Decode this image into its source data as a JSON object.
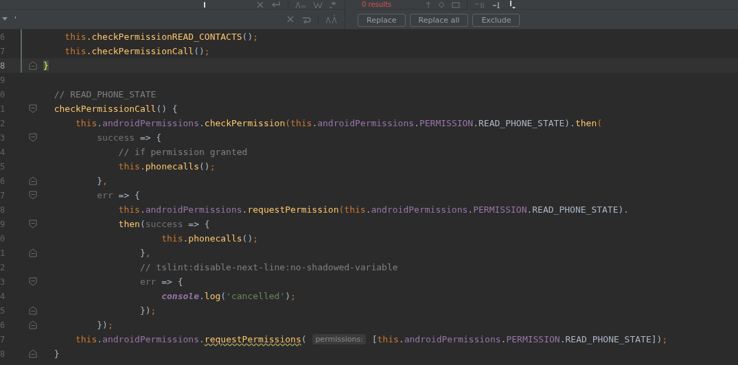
{
  "find_bar": {
    "replace_value": "'",
    "results": "0 results",
    "buttons": [
      "Replace",
      "Replace all",
      "Exclude"
    ]
  },
  "lines": [
    {
      "number": "6",
      "changed": true,
      "tokens": [
        {
          "kind": "keyword",
          "text": "    this"
        },
        {
          "kind": "function",
          "text": ".checkPermissionREAD_CONTACTS"
        },
        {
          "kind": "plain",
          "text": "()"
        },
        {
          "kind": "keyword",
          "text": ";"
        }
      ]
    },
    {
      "number": "7",
      "changed": true,
      "tokens": [
        {
          "kind": "keyword",
          "text": "    this"
        },
        {
          "kind": "function",
          "text": ".checkPermissionCall"
        },
        {
          "kind": "plain",
          "text": "()"
        },
        {
          "kind": "keyword",
          "text": ";"
        }
      ]
    },
    {
      "number": "8",
      "changed": true,
      "current": true,
      "fold_close": true,
      "tokens": [
        {
          "kind": "bracket",
          "text": "}"
        }
      ]
    },
    {
      "number": "9"
    },
    {
      "number": "0",
      "tokens": [
        {
          "kind": "comment",
          "text": "  // READ_PHONE_STATE"
        }
      ]
    },
    {
      "number": "1",
      "fold_open": true,
      "tokens": [
        {
          "kind": "function",
          "text": "  checkPermissionCall"
        },
        {
          "kind": "plain",
          "text": "() {"
        }
      ]
    },
    {
      "number": "2",
      "tokens": [
        {
          "kind": "keyword",
          "text": "      this"
        },
        {
          "kind": "plain",
          "text": "."
        },
        {
          "kind": "property",
          "text": "androidPermissions"
        },
        {
          "kind": "plain",
          "text": "."
        },
        {
          "kind": "function",
          "text": "checkPermission"
        },
        {
          "kind": "keyword",
          "text": "(this"
        },
        {
          "kind": "plain",
          "text": "."
        },
        {
          "kind": "property",
          "text": "androidPermissions"
        },
        {
          "kind": "plain",
          "text": "."
        },
        {
          "kind": "property",
          "text": "PERMISSION"
        },
        {
          "kind": "plain",
          "text": ".READ_PHONE_STATE)."
        },
        {
          "kind": "function",
          "text": "then"
        },
        {
          "kind": "keyword",
          "text": "("
        }
      ]
    },
    {
      "number": "3",
      "fold_open": true,
      "tokens": [
        {
          "kind": "parameter",
          "text": "          success"
        },
        {
          "kind": "plain",
          "text": " => {"
        }
      ]
    },
    {
      "number": "4",
      "tokens": [
        {
          "kind": "comment",
          "text": "              // if permission granted"
        }
      ]
    },
    {
      "number": "5",
      "tokens": [
        {
          "kind": "keyword",
          "text": "              this"
        },
        {
          "kind": "plain",
          "text": "."
        },
        {
          "kind": "function",
          "text": "phonecalls"
        },
        {
          "kind": "plain",
          "text": "()"
        },
        {
          "kind": "keyword",
          "text": ";"
        }
      ]
    },
    {
      "number": "6",
      "fold_close": true,
      "tokens": [
        {
          "kind": "plain",
          "text": "          }"
        },
        {
          "kind": "keyword",
          "text": ","
        }
      ]
    },
    {
      "number": "7",
      "fold_open": true,
      "tokens": [
        {
          "kind": "parameter",
          "text": "          err"
        },
        {
          "kind": "plain",
          "text": " => {"
        }
      ]
    },
    {
      "number": "8",
      "tokens": [
        {
          "kind": "keyword",
          "text": "              this"
        },
        {
          "kind": "plain",
          "text": "."
        },
        {
          "kind": "property",
          "text": "androidPermissions"
        },
        {
          "kind": "plain",
          "text": "."
        },
        {
          "kind": "function",
          "text": "requestPermission"
        },
        {
          "kind": "keyword",
          "text": "(this"
        },
        {
          "kind": "plain",
          "text": "."
        },
        {
          "kind": "property",
          "text": "androidPermissions"
        },
        {
          "kind": "plain",
          "text": "."
        },
        {
          "kind": "property",
          "text": "PERMISSION"
        },
        {
          "kind": "plain",
          "text": ".READ_PHONE_STATE)."
        }
      ]
    },
    {
      "number": "9",
      "fold_open": true,
      "tokens": [
        {
          "kind": "function",
          "text": "              then"
        },
        {
          "kind": "plain",
          "text": "("
        },
        {
          "kind": "parameter",
          "text": "success"
        },
        {
          "kind": "plain",
          "text": " => {"
        }
      ]
    },
    {
      "number": "0",
      "tokens": [
        {
          "kind": "keyword",
          "text": "                      this"
        },
        {
          "kind": "plain",
          "text": "."
        },
        {
          "kind": "function",
          "text": "phonecalls"
        },
        {
          "kind": "plain",
          "text": "()"
        },
        {
          "kind": "keyword",
          "text": ";"
        }
      ]
    },
    {
      "number": "1",
      "fold_close": true,
      "tokens": [
        {
          "kind": "plain",
          "text": "                  }"
        },
        {
          "kind": "keyword",
          "text": ","
        }
      ]
    },
    {
      "number": "2",
      "tokens": [
        {
          "kind": "comment",
          "text": "                  // tslint:disable-next-line:no-shadowed-variable"
        }
      ]
    },
    {
      "number": "3",
      "fold_open": true,
      "tokens": [
        {
          "kind": "parameter",
          "text": "                  err"
        },
        {
          "kind": "plain",
          "text": " => {"
        }
      ]
    },
    {
      "number": "4",
      "tokens": [
        {
          "kind": "global",
          "text": "                      console"
        },
        {
          "kind": "plain",
          "text": "."
        },
        {
          "kind": "function",
          "text": "log"
        },
        {
          "kind": "plain",
          "text": "("
        },
        {
          "kind": "string",
          "text": "'cancelled'"
        },
        {
          "kind": "plain",
          "text": ")"
        },
        {
          "kind": "keyword",
          "text": ";"
        }
      ]
    },
    {
      "number": "5",
      "fold_close": true,
      "tokens": [
        {
          "kind": "plain",
          "text": "                  })"
        },
        {
          "kind": "keyword",
          "text": ";"
        }
      ]
    },
    {
      "number": "6",
      "fold_close": true,
      "tokens": [
        {
          "kind": "plain",
          "text": "          })"
        },
        {
          "kind": "keyword",
          "text": ";"
        }
      ]
    },
    {
      "number": "7",
      "tokens": [
        {
          "kind": "keyword",
          "text": "      this"
        },
        {
          "kind": "plain",
          "text": "."
        },
        {
          "kind": "property",
          "text": "androidPermissions"
        },
        {
          "kind": "plain",
          "text": "."
        },
        {
          "kind": "warning",
          "text": "requestPermissions"
        },
        {
          "kind": "plain",
          "text": "( "
        },
        {
          "kind": "hint",
          "text": "permissions:"
        },
        {
          "kind": "plain",
          "text": " ["
        },
        {
          "kind": "keyword",
          "text": "this"
        },
        {
          "kind": "plain",
          "text": "."
        },
        {
          "kind": "property",
          "text": "androidPermissions"
        },
        {
          "kind": "plain",
          "text": "."
        },
        {
          "kind": "property",
          "text": "PERMISSION"
        },
        {
          "kind": "plain",
          "text": ".READ_PHONE_STATE])"
        },
        {
          "kind": "keyword",
          "text": ";"
        }
      ]
    },
    {
      "number": "8",
      "fold_close": true,
      "tokens": [
        {
          "kind": "plain",
          "text": "  }"
        }
      ]
    }
  ]
}
